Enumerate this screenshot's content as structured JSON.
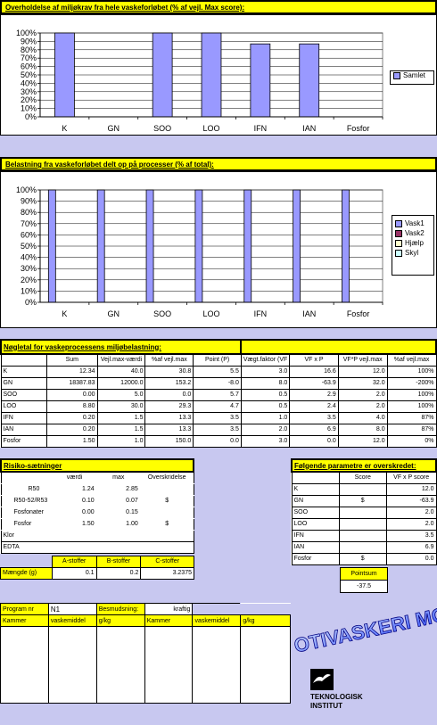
{
  "chart1": {
    "title": "Overholdelse af miljøkrav fra hele vaskeforløbet (% af vejl. Max score):",
    "legend": "Samlet",
    "legend_color": "#9999ff"
  },
  "chart2": {
    "title": "Belastning fra vaskeforløbet delt op på processer (% af total):",
    "legend": [
      "Vask1",
      "Vask2",
      "Hjælp",
      "Skyl"
    ],
    "legend_colors": [
      "#9999ff",
      "#993366",
      "#ffffcc",
      "#ccffff"
    ]
  },
  "chart_data": [
    {
      "type": "bar",
      "title": "Overholdelse af miljøkrav fra hele vaskeforløbet (% af vejl. Max score):",
      "categories": [
        "K",
        "GN",
        "SOO",
        "LOO",
        "IFN",
        "IAN",
        "Fosfor"
      ],
      "yticks": [
        "0%",
        "10%",
        "20%",
        "30%",
        "40%",
        "50%",
        "60%",
        "70%",
        "80%",
        "90%",
        "100%"
      ],
      "ylim": [
        0,
        100
      ],
      "series": [
        {
          "name": "Samlet",
          "values": [
            100,
            0,
            100,
            100,
            87,
            87,
            0
          ]
        }
      ]
    },
    {
      "type": "bar",
      "title": "Belastning fra vaskeforløbet delt op på processer (% af total):",
      "categories": [
        "K",
        "GN",
        "SOO",
        "LOO",
        "IFN",
        "IAN",
        "Fosfor"
      ],
      "yticks": [
        "0%",
        "10%",
        "20%",
        "30%",
        "40%",
        "50%",
        "60%",
        "70%",
        "80%",
        "90%",
        "100%"
      ],
      "ylim": [
        0,
        100
      ],
      "series": [
        {
          "name": "Vask1",
          "values": [
            100,
            100,
            100,
            100,
            100,
            100,
            100
          ]
        },
        {
          "name": "Vask2",
          "values": [
            0,
            0,
            0,
            0,
            0,
            0,
            0
          ]
        },
        {
          "name": "Hjælp",
          "values": [
            0,
            0,
            0,
            0,
            0,
            0,
            0
          ]
        },
        {
          "name": "Skyl",
          "values": [
            0,
            0,
            0,
            0,
            0,
            0,
            0
          ]
        }
      ]
    }
  ],
  "noegletal": {
    "title": "Nøgletal for vaskeprocessens miljøbelastning:",
    "headers": [
      "",
      "Sum",
      "Vejl.max-værdi",
      "%af vejl.max",
      "Point (P)",
      "Vægt.faktor (VF",
      "VF x P",
      "VF*P vejl.max",
      "%af vejl.max"
    ],
    "rows": [
      [
        "K",
        "12.34",
        "40.0",
        "30.8",
        "5.5",
        "3.0",
        "16.6",
        "12.0",
        "100%"
      ],
      [
        "GN",
        "18387.83",
        "12000.0",
        "153.2",
        "-8.0",
        "8.0",
        "-63.9",
        "32.0",
        "-200%"
      ],
      [
        "SOO",
        "0.00",
        "5.0",
        "0.0",
        "5.7",
        "0.5",
        "2.9",
        "2.0",
        "100%"
      ],
      [
        "LOO",
        "8.80",
        "30.0",
        "29.3",
        "4.7",
        "0.5",
        "2.4",
        "2.0",
        "100%"
      ],
      [
        "IFN",
        "0.20",
        "1.5",
        "13.3",
        "3.5",
        "1.0",
        "3.5",
        "4.0",
        "87%"
      ],
      [
        "IAN",
        "0.20",
        "1.5",
        "13.3",
        "3.5",
        "2.0",
        "6.9",
        "8.0",
        "87%"
      ],
      [
        "Fosfor",
        "1.50",
        "1.0",
        "150.0",
        "0.0",
        "3.0",
        "0.0",
        "12.0",
        "0%"
      ]
    ]
  },
  "risiko": {
    "title": "Risiko-sætninger",
    "headers": [
      "",
      "værdi",
      "max",
      "Overskridelse"
    ],
    "rows": [
      [
        "R50",
        "1.24",
        "2.85",
        ""
      ],
      [
        "R50-52/R53",
        "0.10",
        "0.07",
        "$"
      ],
      [
        "Fosfonater",
        "0.00",
        "0.15",
        ""
      ],
      [
        "Fosfor",
        "1.50",
        "1.00",
        "$"
      ]
    ],
    "klor": "Klor",
    "edta": "EDTA",
    "stoffer_headers": [
      "A-stoffer",
      "B-stoffer",
      "C-stoffer"
    ],
    "maengde_label": "Mængde (g)",
    "maengde_values": [
      "0.1",
      "0.2",
      "3.2375"
    ]
  },
  "parametre": {
    "title": "Følgende parametre er overskredet:",
    "headers": [
      "",
      "Score",
      "VF x P score"
    ],
    "rows": [
      [
        "K",
        "",
        "12.0"
      ],
      [
        "GN",
        "$",
        "-63.9"
      ],
      [
        "SOO",
        "",
        "2.0"
      ],
      [
        "LOO",
        "",
        "2.0"
      ],
      [
        "IFN",
        "",
        "3.5"
      ],
      [
        "IAN",
        "",
        "6.9"
      ],
      [
        "Fosfor",
        "$",
        "0.0"
      ]
    ],
    "pointsum_label": "Pointsum",
    "pointsum_value": "-37.5"
  },
  "program": {
    "label": "Program nr",
    "value": "N1",
    "besmudsning_label": "Besmudsning:",
    "besmudsning_value": "kraftig",
    "cols": [
      "Kammer",
      "vaskemiddel",
      "g/kg",
      "Kammer",
      "vaskemiddel",
      "g/kg"
    ]
  },
  "logo": {
    "wordart": "OTIVASKERI MODEL",
    "company1": "TEKNOLOGISK",
    "company2": "INSTITUT"
  }
}
